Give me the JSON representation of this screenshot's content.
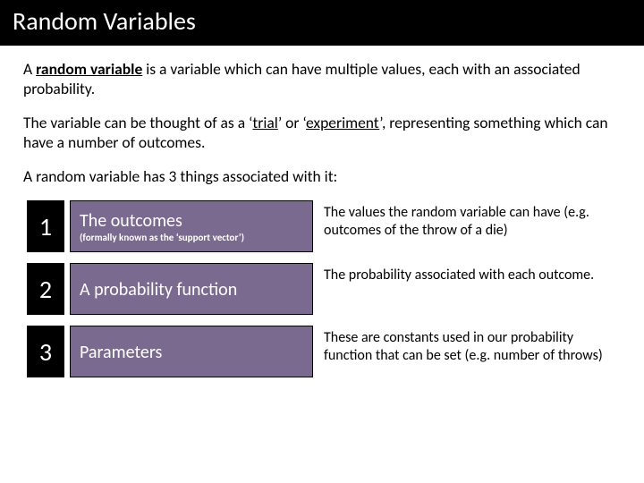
{
  "title": "Random Variables",
  "intro": {
    "p1_prefix": "A ",
    "p1_term": "random variable",
    "p1_rest": " is a variable which can have multiple values, each with an associated probability.",
    "p2_prefix": "The variable can be thought of as a ‘",
    "p2_u1": "trial",
    "p2_mid": "’ or ‘",
    "p2_u2": "experiment",
    "p2_suffix": "’, representing something which can have a number of outcomes.",
    "p3": "A random variable has 3 things associated with it:"
  },
  "items": [
    {
      "num": "1",
      "label": "The outcomes",
      "sub": "(formally known as the ‘support vector’)",
      "desc": "The values the random variable can have (e.g. outcomes of the throw of a die)"
    },
    {
      "num": "2",
      "label": "A probability function",
      "sub": "",
      "desc": "The probability associated with each outcome."
    },
    {
      "num": "3",
      "label": "Parameters",
      "sub": "",
      "desc": "These are constants used in our probability function that can be set (e.g. number of throws)"
    }
  ]
}
